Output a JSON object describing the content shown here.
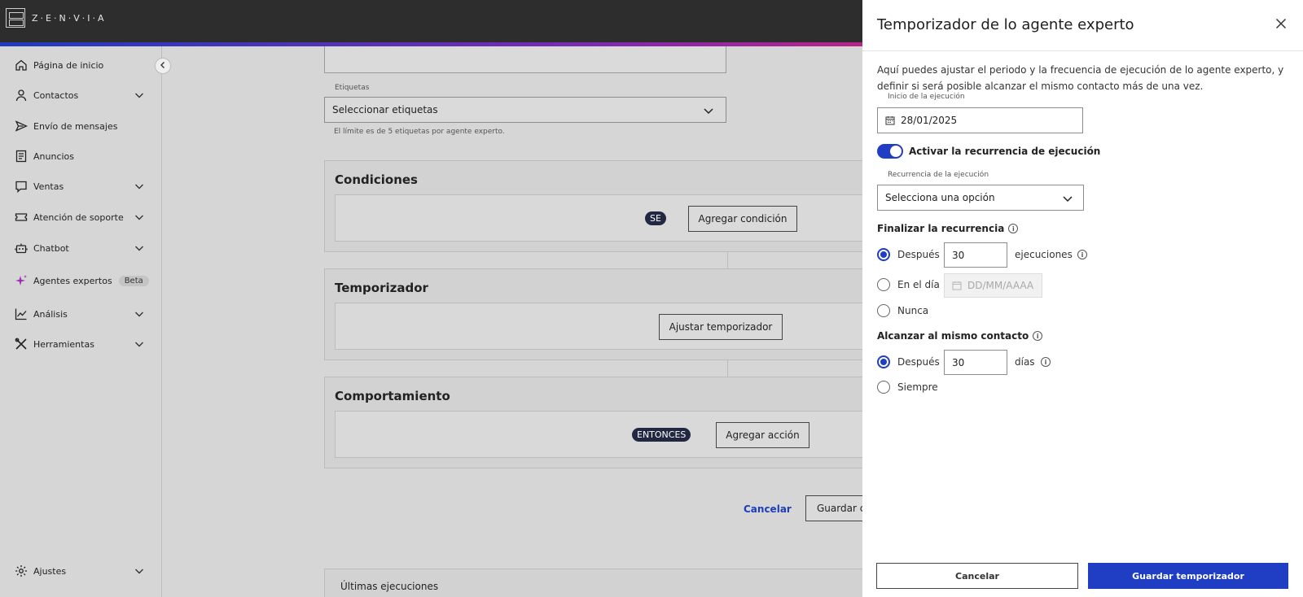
{
  "brand": {
    "name": "Z·E·N·V·I·A"
  },
  "sidebar": {
    "items": [
      {
        "label": "Página de inicio",
        "icon": "home-icon",
        "expandable": false
      },
      {
        "label": "Contactos",
        "icon": "user-icon",
        "expandable": true
      },
      {
        "label": "Envío de mensajes",
        "icon": "send-icon",
        "expandable": false
      },
      {
        "label": "Anuncios",
        "icon": "document-icon",
        "expandable": false
      },
      {
        "label": "Ventas",
        "icon": "chat-icon",
        "expandable": true
      },
      {
        "label": "Atención de soporte",
        "icon": "ticket-icon",
        "expandable": true
      },
      {
        "label": "Chatbot",
        "icon": "robot-icon",
        "expandable": true
      },
      {
        "label": "Agentes expertos",
        "icon": "sparkle-icon",
        "expandable": false,
        "badge": "Beta"
      },
      {
        "label": "Análisis",
        "icon": "chart-icon",
        "expandable": true
      },
      {
        "label": "Herramientas",
        "icon": "tools-icon",
        "expandable": true
      }
    ],
    "settings": {
      "label": "Ajustes",
      "icon": "gear-icon"
    }
  },
  "main": {
    "tags": {
      "label": "Etiquetas",
      "value": "Seleccionar etiquetas",
      "hint": "El límite es de 5 etiquetas por agente experto."
    },
    "conditions": {
      "title": "Condiciones",
      "pill": "SE",
      "button": "Agregar condición"
    },
    "timer": {
      "title": "Temporizador",
      "button": "Ajustar temporizador"
    },
    "behavior": {
      "title": "Comportamiento",
      "pill": "ENTONCES",
      "button": "Agregar acción"
    },
    "actions": {
      "cancel": "Cancelar",
      "save": "Guardar c"
    },
    "last_runs": "Últimas ejecuciones"
  },
  "drawer": {
    "title": "Temporizador de lo agente experto",
    "description": "Aquí puedes ajustar el periodo y la frecuencia de ejecución de lo agente experto, y definir si será posible alcanzar el mismo contacto más de una vez.",
    "start": {
      "label": "Inicio de la ejecución",
      "value": "28/01/2025"
    },
    "recurrence_toggle": {
      "label": "Activar la recurrencia de ejecución",
      "on": true
    },
    "recurrence": {
      "label": "Recurrencia de la ejecución",
      "value": "Selecciona una opción"
    },
    "end": {
      "label": "Finalizar la recurrencia",
      "after_label": "Después",
      "after_value": "30",
      "after_unit": "ejecuciones",
      "on_day_label": "En el día",
      "on_day_placeholder": "DD/MM/AAAA",
      "never_label": "Nunca",
      "selected": "after"
    },
    "reach": {
      "label": "Alcanzar al mismo contacto",
      "after_label": "Después",
      "after_value": "30",
      "after_unit": "días",
      "always_label": "Siempre",
      "selected": "after"
    },
    "footer": {
      "cancel": "Cancelar",
      "save": "Guardar temporizador"
    }
  },
  "colors": {
    "primary": "#1f3ec4",
    "topbar": "#2d2d2d",
    "overlay": "#d6d6d6"
  }
}
